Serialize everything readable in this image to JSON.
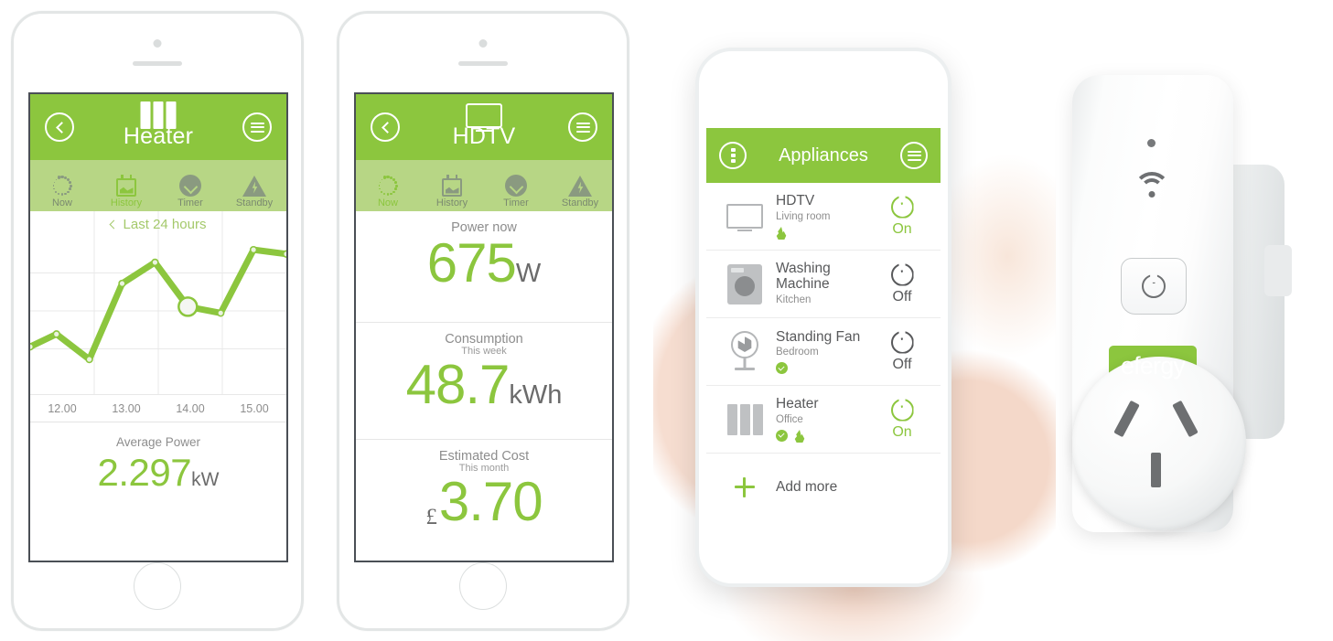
{
  "phone1": {
    "header": {
      "title": "Heater",
      "icon": "heater-icon",
      "back_icon": "chevron-left-icon",
      "menu_icon": "hamburger-menu-icon"
    },
    "tabs": [
      {
        "label": "Now",
        "icon": "spinner-dots-icon",
        "active": false
      },
      {
        "label": "History",
        "icon": "calendar-chart-icon",
        "active": true
      },
      {
        "label": "Timer",
        "icon": "clock-icon",
        "active": false
      },
      {
        "label": "Standby",
        "icon": "standby-bolt-icon",
        "active": false
      }
    ],
    "chart_nav": "Last 24 hours",
    "summary": {
      "label": "Average Power",
      "value": "2.297",
      "unit": "kW"
    }
  },
  "phone2": {
    "header": {
      "title": "HDTV",
      "icon": "tv-icon",
      "back_icon": "chevron-left-icon",
      "menu_icon": "hamburger-menu-icon"
    },
    "tabs": [
      {
        "label": "Now",
        "icon": "spinner-dots-icon",
        "active": true
      },
      {
        "label": "History",
        "icon": "calendar-chart-icon",
        "active": false
      },
      {
        "label": "Timer",
        "icon": "clock-icon",
        "active": false
      },
      {
        "label": "Standby",
        "icon": "standby-bolt-icon",
        "active": false
      }
    ],
    "stats": [
      {
        "label": "Power now",
        "sub": "",
        "currency": "",
        "value": "675",
        "unit": "W"
      },
      {
        "label": "Consumption",
        "sub": "This week",
        "currency": "",
        "value": "48.7",
        "unit": "kWh"
      },
      {
        "label": "Estimated Cost",
        "sub": "This month",
        "currency": "£",
        "value": "3.70",
        "unit": ""
      }
    ]
  },
  "phone3": {
    "header": {
      "title": "Appliances",
      "left_icon": "vertical-dots-icon",
      "menu_icon": "hamburger-menu-icon"
    },
    "rows": [
      {
        "name": "HDTV",
        "location": "Living room",
        "state": "On",
        "on": true,
        "icon": "tv-thumb-icon",
        "badges": [
          "flame-badge"
        ]
      },
      {
        "name": "Washing Machine",
        "location": "Kitchen",
        "state": "Off",
        "on": false,
        "icon": "washing-machine-thumb-icon",
        "badges": []
      },
      {
        "name": "Standing Fan",
        "location": "Bedroom",
        "state": "Off",
        "on": false,
        "icon": "fan-thumb-icon",
        "badges": [
          "timer-badge"
        ]
      },
      {
        "name": "Heater",
        "location": "Office",
        "state": "On",
        "on": true,
        "icon": "heater-thumb-icon",
        "badges": [
          "timer-badge",
          "flame-badge"
        ]
      }
    ],
    "add_more": {
      "label": "Add more",
      "icon": "plus-icon"
    }
  },
  "device": {
    "brand": "efergy",
    "led": "status-led",
    "wifi_icon": "wifi-icon",
    "power_button_icon": "power-button-icon",
    "socket": "au-socket"
  },
  "colors": {
    "brand_green": "#8cc63e",
    "tabbar_green": "#b7d685",
    "text_grey": "#58595b",
    "muted_grey": "#8d8d8d"
  },
  "chart_data": {
    "type": "line",
    "title": "Last 24 hours",
    "xlabel": "",
    "ylabel": "",
    "grid": true,
    "legend": false,
    "xticks": [
      "12.00",
      "13.00",
      "14.00",
      "15.00"
    ],
    "x": [
      11.6,
      12.0,
      12.5,
      13.0,
      13.5,
      14.0,
      14.5,
      15.0,
      15.5
    ],
    "values": [
      1.75,
      2.05,
      1.45,
      3.25,
      3.75,
      2.7,
      2.55,
      4.05,
      3.95
    ],
    "ylim": [
      0.8,
      4.4
    ],
    "highlight_index": 5,
    "unit": "kW"
  }
}
